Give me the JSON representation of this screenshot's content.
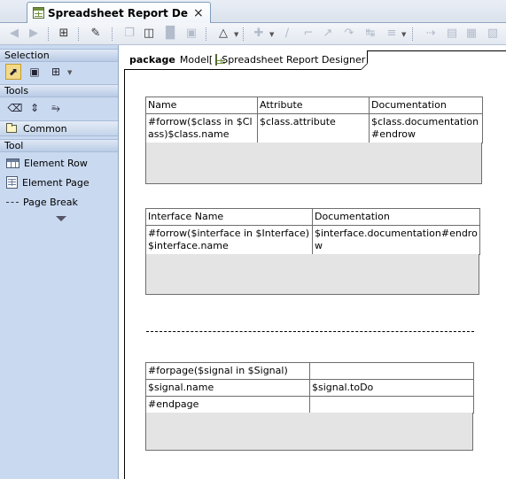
{
  "tab": {
    "title": "Spreadsheet Report Desig...",
    "close": "×"
  },
  "toolbar": {
    "buttons": [
      "back-arrow",
      "forward-arrow",
      "tree-navigate",
      "edit-diagram",
      "copy",
      "paste",
      "delete",
      "delete-from-model",
      "hierarchy-layout",
      "add-node",
      "connector",
      "rectilinear-path",
      "oblique-path",
      "bezier-path",
      "route",
      "align",
      "fit-width",
      "row",
      "cell",
      "column",
      "page"
    ]
  },
  "palette": {
    "selection_header": "Selection",
    "tools_header": "Tools",
    "common_label": "Common",
    "tool_header": "Tool",
    "items": [
      {
        "label": "Element Row",
        "icon": "element-row-icon"
      },
      {
        "label": "Element Page",
        "icon": "element-page-icon"
      },
      {
        "label": "Page Break",
        "icon": "page-break-icon"
      }
    ]
  },
  "diagram": {
    "frame_keyword": "package",
    "frame_model": "Model",
    "frame_bracket_open": "[",
    "frame_name": "Spreadsheet Report Designer",
    "frame_bracket_close": "]"
  },
  "tables": {
    "class_table": {
      "headers": [
        "Name",
        "Attribute",
        "Documentation"
      ],
      "row": [
        "#forrow($class in $Class)$class.name",
        "$class.attribute",
        "$class.documentation#endrow"
      ]
    },
    "interface_table": {
      "headers": [
        "Interface Name",
        "Documentation"
      ],
      "row": [
        "#forrow($interface in $Interface)$interface.name",
        "$interface.documentation#endrow"
      ]
    },
    "signal_table": {
      "rows": [
        [
          "#forpage($signal in $Signal)",
          ""
        ],
        [
          "$signal.name",
          "$signal.toDo"
        ],
        [
          "#endpage",
          ""
        ]
      ]
    }
  },
  "colors": {
    "palette_bg": "#c9d9f0",
    "filler_gray": "#e4e4e4",
    "selected_tool": "#f3d98a"
  }
}
